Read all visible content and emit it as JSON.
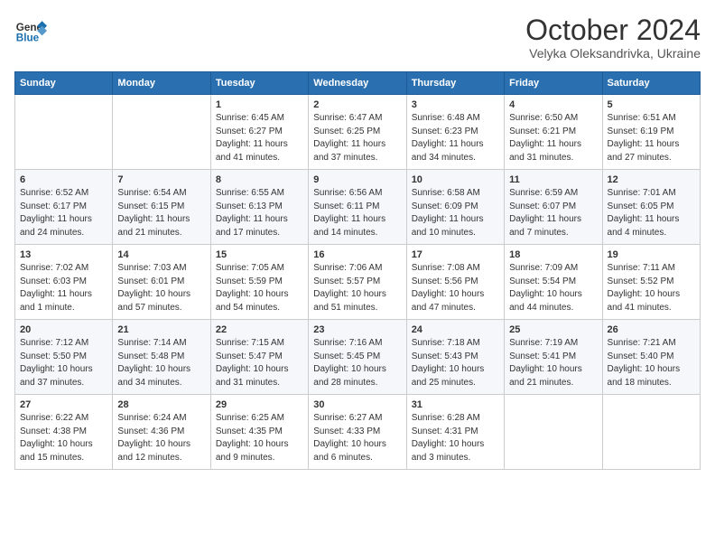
{
  "header": {
    "logo_line1": "General",
    "logo_line2": "Blue",
    "month_title": "October 2024",
    "location": "Velyka Oleksandrivka, Ukraine"
  },
  "weekdays": [
    "Sunday",
    "Monday",
    "Tuesday",
    "Wednesday",
    "Thursday",
    "Friday",
    "Saturday"
  ],
  "weeks": [
    [
      {
        "day": "",
        "sunrise": "",
        "sunset": "",
        "daylight": ""
      },
      {
        "day": "",
        "sunrise": "",
        "sunset": "",
        "daylight": ""
      },
      {
        "day": "1",
        "sunrise": "Sunrise: 6:45 AM",
        "sunset": "Sunset: 6:27 PM",
        "daylight": "Daylight: 11 hours and 41 minutes."
      },
      {
        "day": "2",
        "sunrise": "Sunrise: 6:47 AM",
        "sunset": "Sunset: 6:25 PM",
        "daylight": "Daylight: 11 hours and 37 minutes."
      },
      {
        "day": "3",
        "sunrise": "Sunrise: 6:48 AM",
        "sunset": "Sunset: 6:23 PM",
        "daylight": "Daylight: 11 hours and 34 minutes."
      },
      {
        "day": "4",
        "sunrise": "Sunrise: 6:50 AM",
        "sunset": "Sunset: 6:21 PM",
        "daylight": "Daylight: 11 hours and 31 minutes."
      },
      {
        "day": "5",
        "sunrise": "Sunrise: 6:51 AM",
        "sunset": "Sunset: 6:19 PM",
        "daylight": "Daylight: 11 hours and 27 minutes."
      }
    ],
    [
      {
        "day": "6",
        "sunrise": "Sunrise: 6:52 AM",
        "sunset": "Sunset: 6:17 PM",
        "daylight": "Daylight: 11 hours and 24 minutes."
      },
      {
        "day": "7",
        "sunrise": "Sunrise: 6:54 AM",
        "sunset": "Sunset: 6:15 PM",
        "daylight": "Daylight: 11 hours and 21 minutes."
      },
      {
        "day": "8",
        "sunrise": "Sunrise: 6:55 AM",
        "sunset": "Sunset: 6:13 PM",
        "daylight": "Daylight: 11 hours and 17 minutes."
      },
      {
        "day": "9",
        "sunrise": "Sunrise: 6:56 AM",
        "sunset": "Sunset: 6:11 PM",
        "daylight": "Daylight: 11 hours and 14 minutes."
      },
      {
        "day": "10",
        "sunrise": "Sunrise: 6:58 AM",
        "sunset": "Sunset: 6:09 PM",
        "daylight": "Daylight: 11 hours and 10 minutes."
      },
      {
        "day": "11",
        "sunrise": "Sunrise: 6:59 AM",
        "sunset": "Sunset: 6:07 PM",
        "daylight": "Daylight: 11 hours and 7 minutes."
      },
      {
        "day": "12",
        "sunrise": "Sunrise: 7:01 AM",
        "sunset": "Sunset: 6:05 PM",
        "daylight": "Daylight: 11 hours and 4 minutes."
      }
    ],
    [
      {
        "day": "13",
        "sunrise": "Sunrise: 7:02 AM",
        "sunset": "Sunset: 6:03 PM",
        "daylight": "Daylight: 11 hours and 1 minute."
      },
      {
        "day": "14",
        "sunrise": "Sunrise: 7:03 AM",
        "sunset": "Sunset: 6:01 PM",
        "daylight": "Daylight: 10 hours and 57 minutes."
      },
      {
        "day": "15",
        "sunrise": "Sunrise: 7:05 AM",
        "sunset": "Sunset: 5:59 PM",
        "daylight": "Daylight: 10 hours and 54 minutes."
      },
      {
        "day": "16",
        "sunrise": "Sunrise: 7:06 AM",
        "sunset": "Sunset: 5:57 PM",
        "daylight": "Daylight: 10 hours and 51 minutes."
      },
      {
        "day": "17",
        "sunrise": "Sunrise: 7:08 AM",
        "sunset": "Sunset: 5:56 PM",
        "daylight": "Daylight: 10 hours and 47 minutes."
      },
      {
        "day": "18",
        "sunrise": "Sunrise: 7:09 AM",
        "sunset": "Sunset: 5:54 PM",
        "daylight": "Daylight: 10 hours and 44 minutes."
      },
      {
        "day": "19",
        "sunrise": "Sunrise: 7:11 AM",
        "sunset": "Sunset: 5:52 PM",
        "daylight": "Daylight: 10 hours and 41 minutes."
      }
    ],
    [
      {
        "day": "20",
        "sunrise": "Sunrise: 7:12 AM",
        "sunset": "Sunset: 5:50 PM",
        "daylight": "Daylight: 10 hours and 37 minutes."
      },
      {
        "day": "21",
        "sunrise": "Sunrise: 7:14 AM",
        "sunset": "Sunset: 5:48 PM",
        "daylight": "Daylight: 10 hours and 34 minutes."
      },
      {
        "day": "22",
        "sunrise": "Sunrise: 7:15 AM",
        "sunset": "Sunset: 5:47 PM",
        "daylight": "Daylight: 10 hours and 31 minutes."
      },
      {
        "day": "23",
        "sunrise": "Sunrise: 7:16 AM",
        "sunset": "Sunset: 5:45 PM",
        "daylight": "Daylight: 10 hours and 28 minutes."
      },
      {
        "day": "24",
        "sunrise": "Sunrise: 7:18 AM",
        "sunset": "Sunset: 5:43 PM",
        "daylight": "Daylight: 10 hours and 25 minutes."
      },
      {
        "day": "25",
        "sunrise": "Sunrise: 7:19 AM",
        "sunset": "Sunset: 5:41 PM",
        "daylight": "Daylight: 10 hours and 21 minutes."
      },
      {
        "day": "26",
        "sunrise": "Sunrise: 7:21 AM",
        "sunset": "Sunset: 5:40 PM",
        "daylight": "Daylight: 10 hours and 18 minutes."
      }
    ],
    [
      {
        "day": "27",
        "sunrise": "Sunrise: 6:22 AM",
        "sunset": "Sunset: 4:38 PM",
        "daylight": "Daylight: 10 hours and 15 minutes."
      },
      {
        "day": "28",
        "sunrise": "Sunrise: 6:24 AM",
        "sunset": "Sunset: 4:36 PM",
        "daylight": "Daylight: 10 hours and 12 minutes."
      },
      {
        "day": "29",
        "sunrise": "Sunrise: 6:25 AM",
        "sunset": "Sunset: 4:35 PM",
        "daylight": "Daylight: 10 hours and 9 minutes."
      },
      {
        "day": "30",
        "sunrise": "Sunrise: 6:27 AM",
        "sunset": "Sunset: 4:33 PM",
        "daylight": "Daylight: 10 hours and 6 minutes."
      },
      {
        "day": "31",
        "sunrise": "Sunrise: 6:28 AM",
        "sunset": "Sunset: 4:31 PM",
        "daylight": "Daylight: 10 hours and 3 minutes."
      },
      {
        "day": "",
        "sunrise": "",
        "sunset": "",
        "daylight": ""
      },
      {
        "day": "",
        "sunrise": "",
        "sunset": "",
        "daylight": ""
      }
    ]
  ]
}
